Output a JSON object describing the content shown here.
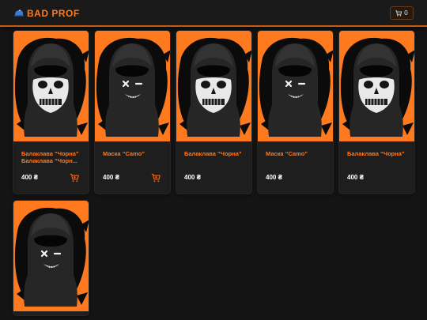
{
  "app": {
    "brand": "BAD PROF",
    "brand_icon": "cap-icon",
    "cart_count": "0",
    "accent": "#ff7a1f"
  },
  "products": [
    {
      "name": "Балаклава “Чорна” Балаклава “Чорн...",
      "price": "400 ₴",
      "design": "skull",
      "cart_button": true
    },
    {
      "name": "Маска “Camo”",
      "price": "400 ₴",
      "design": "smile",
      "cart_button": true
    },
    {
      "name": "Балаклава “Чорна”",
      "price": "400 ₴",
      "design": "skull",
      "cart_button": false
    },
    {
      "name": "Маска “Camo”",
      "price": "400 ₴",
      "design": "smile",
      "cart_button": false
    },
    {
      "name": "Балаклава “Чорна”",
      "price": "400 ₴",
      "design": "skull",
      "cart_button": false
    },
    {
      "name": "",
      "price": "",
      "design": "smile",
      "cart_button": false
    }
  ]
}
